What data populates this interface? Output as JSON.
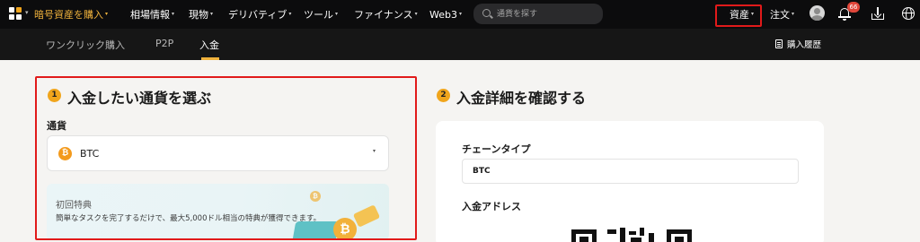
{
  "topnav": {
    "items": [
      {
        "label": "暗号資産を購入",
        "caret": "▾"
      },
      {
        "label": "相場情報",
        "caret": "▾"
      },
      {
        "label": "現物",
        "caret": "▾"
      },
      {
        "label": "デリバティブ",
        "caret": "▾"
      },
      {
        "label": "ツール",
        "caret": "▾"
      },
      {
        "label": "ファイナンス",
        "caret": "▾"
      },
      {
        "label": "Web3",
        "caret": "▾"
      }
    ],
    "search_placeholder": "通貨を探す",
    "assets_label": "資産",
    "orders_label": "注文",
    "caret": "▾",
    "notification_count": "66",
    "accent_color": "#f0b23c",
    "highlight_color": "#e11a1a"
  },
  "subnav": {
    "tabs": [
      {
        "label": "ワンクリック購入"
      },
      {
        "label": "P2P"
      },
      {
        "label": "入金"
      }
    ],
    "history_label": "購入履歴"
  },
  "step1": {
    "number": "1",
    "title": "入金したい通貨を選ぶ",
    "currency_label": "通貨",
    "selected_coin_symbol": "₿",
    "selected_coin": "BTC",
    "promo_title": "初回特典",
    "promo_text": "簡単なタスクを完了するだけで、最大5,000ドル相当の特典が獲得できます。"
  },
  "step2": {
    "number": "2",
    "title": "入金詳細を確認する",
    "chain_type_label": "チェーンタイプ",
    "chain_type_value": "BTC",
    "address_label": "入金アドレス"
  }
}
